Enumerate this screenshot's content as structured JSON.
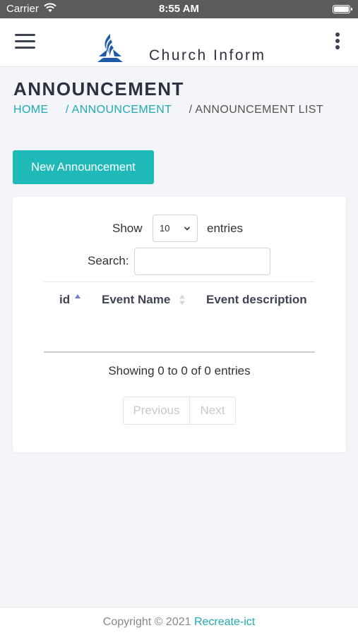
{
  "status_bar": {
    "carrier": "Carrier",
    "time": "8:55 AM"
  },
  "navbar": {
    "brand": "Church Inform",
    "menu_icon": "hamburger-menu-icon",
    "more_icon": "kebab-menu-icon",
    "logo": "church-logo"
  },
  "page": {
    "title": "ANNOUNCEMENT",
    "breadcrumb": {
      "home": "HOME",
      "section": "/ ANNOUNCEMENT",
      "current": "/ ANNOUNCEMENT LIST"
    }
  },
  "actions": {
    "new_label": "New Announcement",
    "accent": "#1fbab8"
  },
  "datatable": {
    "show_label": "Show",
    "page_length": "10",
    "entries_label": "entries",
    "search_label": "Search:",
    "search_value": "",
    "columns": [
      "id",
      "Event Name",
      "Event description"
    ],
    "rows": [],
    "info": "Showing 0 to 0 of 0 entries",
    "pagination": {
      "previous": "Previous",
      "next": "Next"
    }
  },
  "footer": {
    "copyright": "Copyright © 2021",
    "company": "Recreate-ict"
  }
}
